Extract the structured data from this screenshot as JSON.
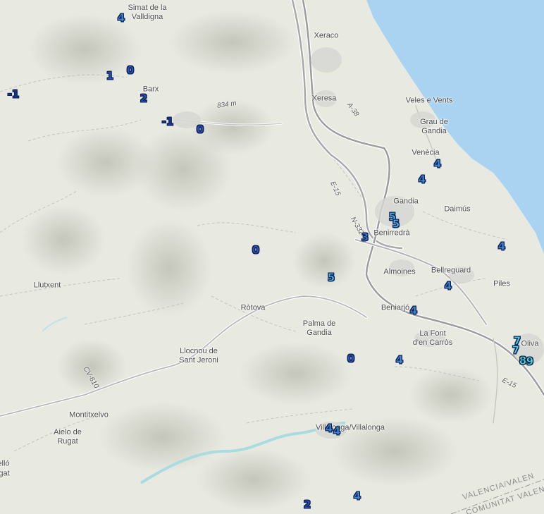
{
  "map": {
    "places": [
      {
        "id": "simat",
        "name": "Simat de la\nValldigna"
      },
      {
        "id": "xeraco",
        "name": "Xeraco"
      },
      {
        "id": "barx",
        "name": "Barx"
      },
      {
        "id": "xeresa",
        "name": "Xeresa"
      },
      {
        "id": "veles",
        "name": "Veles e Vents"
      },
      {
        "id": "grau",
        "name": "Grau de\nGandia"
      },
      {
        "id": "venecia",
        "name": "Venècia"
      },
      {
        "id": "gandia",
        "name": "Gandia"
      },
      {
        "id": "daimus",
        "name": "Daimús"
      },
      {
        "id": "benirredra",
        "name": "Benirredrà"
      },
      {
        "id": "almoines",
        "name": "Almoines"
      },
      {
        "id": "bellreguard",
        "name": "Bellreguard"
      },
      {
        "id": "piles",
        "name": "Piles"
      },
      {
        "id": "llutxent",
        "name": "Llutxent"
      },
      {
        "id": "rotova",
        "name": "Ròtova"
      },
      {
        "id": "beniarjo",
        "name": "Beniarjó"
      },
      {
        "id": "palma",
        "name": "Palma de\nGandia"
      },
      {
        "id": "lafont",
        "name": "La Font\nd'en Carròs"
      },
      {
        "id": "oliva",
        "name": "Oliva"
      },
      {
        "id": "llocnou",
        "name": "Llocnou de\nSant Jeroni"
      },
      {
        "id": "montitxelvo",
        "name": "Montitxelvo"
      },
      {
        "id": "aielo",
        "name": "Aielo de\nRugat"
      },
      {
        "id": "ello",
        "name": "elló"
      },
      {
        "id": "gat",
        "name": "gat"
      },
      {
        "id": "villalonga",
        "name": "Villalonga/Villalonga"
      }
    ],
    "road_labels": [
      {
        "id": "peak",
        "text": "834 m"
      },
      {
        "id": "a38",
        "text": "A-38"
      },
      {
        "id": "e15a",
        "text": "E-15"
      },
      {
        "id": "n332",
        "text": "N-332"
      },
      {
        "id": "cv610",
        "text": "CV-610"
      },
      {
        "id": "e15b",
        "text": "E-15"
      }
    ],
    "regions": [
      {
        "id": "valencia",
        "text": "VALENCIA/VALEN"
      },
      {
        "id": "comunitat",
        "text": "COMUNITAT VALEN"
      }
    ],
    "markers": [
      {
        "value": "4",
        "color": "#3d8fd6"
      },
      {
        "value": "0",
        "color": "#2a55b8"
      },
      {
        "value": "1",
        "color": "#2a55b8"
      },
      {
        "value": "-1",
        "color": "#1d3a9a"
      },
      {
        "value": "2",
        "color": "#2a55b8"
      },
      {
        "value": "-1",
        "color": "#1d3a9a"
      },
      {
        "value": "0",
        "color": "#2a55b8"
      },
      {
        "value": "4",
        "color": "#3d8fd6"
      },
      {
        "value": "4",
        "color": "#3d8fd6"
      },
      {
        "value": "5",
        "color": "#45b5e8"
      },
      {
        "value": "5",
        "color": "#45b5e8"
      },
      {
        "value": "3",
        "color": "#3476cc"
      },
      {
        "value": "0",
        "color": "#2a55b8"
      },
      {
        "value": "4",
        "color": "#3d8fd6"
      },
      {
        "value": "5",
        "color": "#45b5e8"
      },
      {
        "value": "4",
        "color": "#3d8fd6"
      },
      {
        "value": "4",
        "color": "#3d8fd6"
      },
      {
        "value": "7",
        "color": "#49d4df"
      },
      {
        "value": "7",
        "color": "#49d4df"
      },
      {
        "value": "8",
        "color": "#4fe0cf"
      },
      {
        "value": "9",
        "color": "#4fe0cf"
      },
      {
        "value": "0",
        "color": "#2a55b8"
      },
      {
        "value": "4",
        "color": "#3d8fd6"
      },
      {
        "value": "4",
        "color": "#3d8fd6"
      },
      {
        "value": "4",
        "color": "#3d8fd6"
      },
      {
        "value": "2",
        "color": "#2a55b8"
      },
      {
        "value": "4",
        "color": "#3d8fd6"
      }
    ]
  },
  "colors": {
    "sea": "#a9d3f0",
    "land": "#e8eae2",
    "road": "#b0b0b0",
    "hill": "#c9cabf"
  }
}
